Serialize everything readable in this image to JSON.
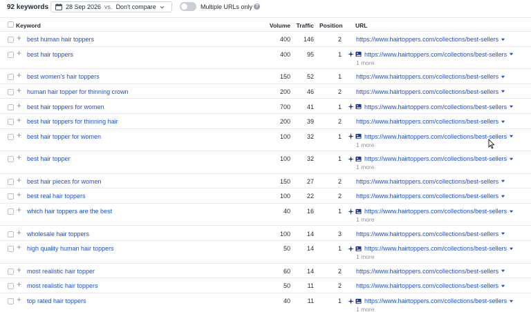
{
  "toolbar": {
    "keyword_count": "92 keywords",
    "date": "28 Sep 2026",
    "vs": "vs.",
    "compare": "Don't compare",
    "toggle_label": "Multiple URLs only",
    "help": "?"
  },
  "columns": {
    "keyword": "Keyword",
    "volume": "Volume",
    "traffic": "Traffic",
    "position": "Position",
    "url": "URL"
  },
  "rows": [
    {
      "keyword": "best human hair toppers",
      "volume": "400",
      "traffic": "146",
      "position": "2",
      "url": "https://www.hairtoppers.com/collections/best-sellers",
      "features": false,
      "more": ""
    },
    {
      "keyword": "best hair toppers",
      "volume": "400",
      "traffic": "95",
      "position": "1",
      "url": "https://www.hairtoppers.com/collections/best-sellers",
      "features": true,
      "more": "1 more"
    },
    {
      "keyword": "best women's hair toppers",
      "volume": "150",
      "traffic": "52",
      "position": "1",
      "url": "https://www.hairtoppers.com/collections/best-sellers",
      "features": false,
      "more": ""
    },
    {
      "keyword": "human hair topper for thinning crown",
      "volume": "200",
      "traffic": "46",
      "position": "2",
      "url": "https://www.hairtoppers.com/collections/best-sellers",
      "features": false,
      "more": ""
    },
    {
      "keyword": "best hair toppers for women",
      "volume": "700",
      "traffic": "41",
      "position": "1",
      "url": "https://www.hairtoppers.com/collections/best-sellers",
      "features": true,
      "more": ""
    },
    {
      "keyword": "best hair toppers for thinning hair",
      "volume": "200",
      "traffic": "39",
      "position": "2",
      "url": "https://www.hairtoppers.com/collections/best-sellers",
      "features": false,
      "more": ""
    },
    {
      "keyword": "best hair topper for women",
      "volume": "100",
      "traffic": "32",
      "position": "1",
      "url": "https://www.hairtoppers.com/collections/best-sellers",
      "features": true,
      "more": "1 more"
    },
    {
      "keyword": "best hair topper",
      "volume": "100",
      "traffic": "32",
      "position": "1",
      "url": "https://www.hairtoppers.com/collections/best-sellers",
      "features": true,
      "more": "1 more"
    },
    {
      "keyword": "best hair pieces for women",
      "volume": "150",
      "traffic": "27",
      "position": "2",
      "url": "https://www.hairtoppers.com/collections/best-sellers",
      "features": false,
      "more": ""
    },
    {
      "keyword": "best real hair toppers",
      "volume": "100",
      "traffic": "22",
      "position": "2",
      "url": "https://www.hairtoppers.com/collections/best-sellers",
      "features": false,
      "more": ""
    },
    {
      "keyword": "which hair toppers are the best",
      "volume": "40",
      "traffic": "16",
      "position": "1",
      "url": "https://www.hairtoppers.com/collections/best-sellers",
      "features": true,
      "more": "1 more"
    },
    {
      "keyword": "wholesale hair toppers",
      "volume": "100",
      "traffic": "14",
      "position": "3",
      "url": "https://www.hairtoppers.com/collections/best-sellers",
      "features": false,
      "more": ""
    },
    {
      "keyword": "high quality human hair toppers",
      "volume": "50",
      "traffic": "14",
      "position": "1",
      "url": "https://www.hairtoppers.com/collections/best-sellers",
      "features": true,
      "more": "1 more"
    },
    {
      "keyword": "most realistic hair topper",
      "volume": "60",
      "traffic": "14",
      "position": "2",
      "url": "https://www.hairtoppers.com/collections/best-sellers",
      "features": false,
      "more": ""
    },
    {
      "keyword": "most realistic hair toppers",
      "volume": "50",
      "traffic": "11",
      "position": "2",
      "url": "https://www.hairtoppers.com/collections/best-sellers",
      "features": false,
      "more": ""
    },
    {
      "keyword": "top rated hair toppers",
      "volume": "40",
      "traffic": "11",
      "position": "1",
      "url": "https://www.hairtoppers.com/collections/best-sellers",
      "features": true,
      "more": "1 more"
    }
  ],
  "colors": {
    "link": "#1d4ed8",
    "muted": "#8a939d",
    "border": "#e5e8ec"
  }
}
